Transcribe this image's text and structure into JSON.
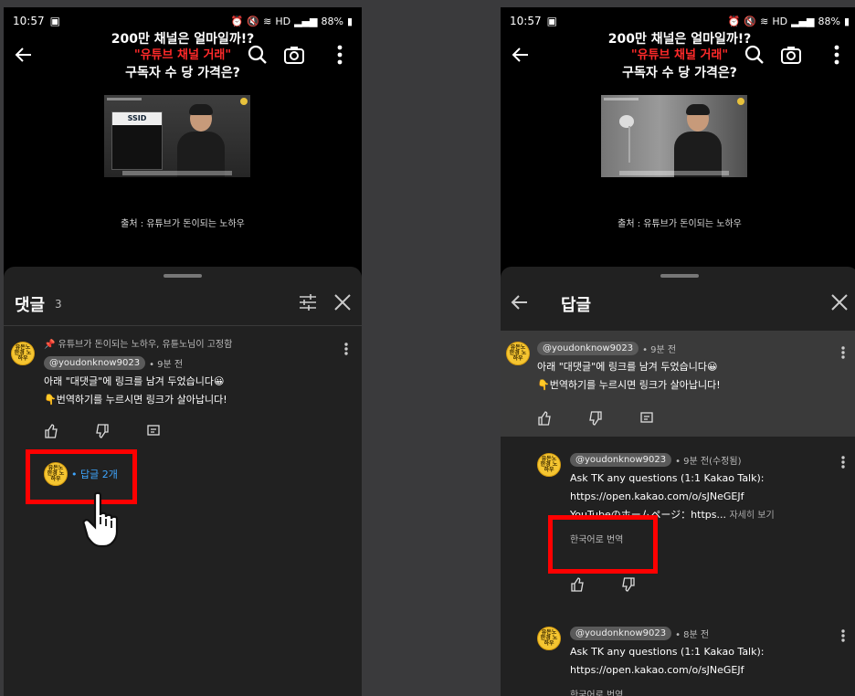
{
  "status": {
    "time": "10:57",
    "battery": "88%",
    "network": "HD"
  },
  "video": {
    "title_line1": "200만 채널은 얼마일까!?",
    "title_line2": "\"유튜브 채널 거래\"",
    "title_line3": "구독자 수 당 가격은?",
    "source": "출처 : 유튜브가 돈이되는 노하우",
    "thumb_card_logo": "SSID"
  },
  "left_panel": {
    "title": "댓글",
    "count": "3",
    "pinned": "📌 유튜브가 돈이되는 노하우, 유튠노님이 고정함",
    "comment": {
      "handle": "@youdonknow9023",
      "time": "• 9분 전",
      "line1": "아래 \"대댓글\"에 링크를 남겨 두었습니다😀",
      "line2": "👇번역하기를 누르시면 링크가 살아납니다!",
      "avatar_text": "유돈노 한경 노하우"
    },
    "reply_link": "• 답글 2개"
  },
  "right_panel": {
    "title": "답글",
    "parent": {
      "handle": "@youdonknow9023",
      "time": "• 9분 전",
      "line1": "아래 \"대댓글\"에 링크를 남겨 두었습니다😀",
      "line2": "👇번역하기를 누르시면 링크가 살아납니다!"
    },
    "reply1": {
      "handle": "@youdonknow9023",
      "time": "• 9분 전(수정됨)",
      "line1": "Ask TK any questions (1:1 Kakao Talk):",
      "line2": "https://open.kakao.com/o/sJNeGEJf",
      "line3": "YouTubeのホームページ：https...",
      "see_more": "자세히 보기",
      "translate": "한국어로 번역"
    },
    "reply2": {
      "handle": "@youdonknow9023",
      "time": "• 8분 전",
      "line1": "Ask TK any questions (1:1 Kakao Talk):",
      "line2": "https://open.kakao.com/o/sJNeGEJf",
      "translate": "한국어로 번역"
    }
  },
  "colors": {
    "accent_red": "#ff0000",
    "link_blue": "#3ea6ff",
    "avatar_yellow": "#f5c531"
  }
}
